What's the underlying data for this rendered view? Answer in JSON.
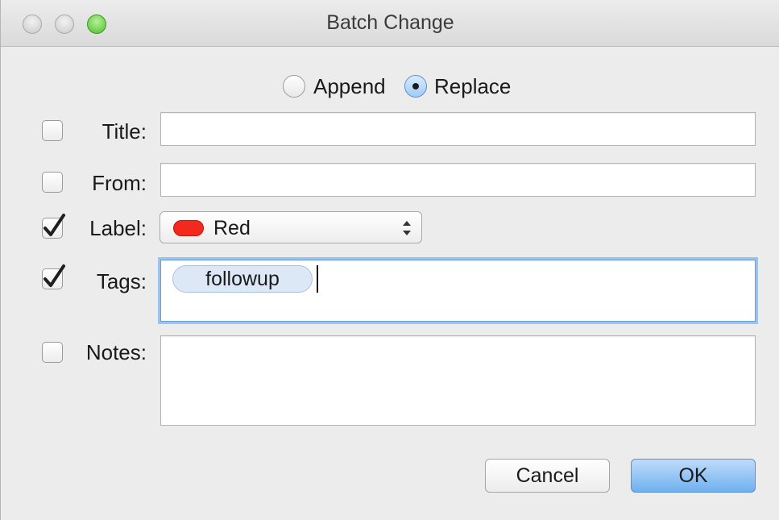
{
  "window": {
    "title": "Batch Change"
  },
  "mode": {
    "options": [
      {
        "label": "Append",
        "selected": false
      },
      {
        "label": "Replace",
        "selected": true
      }
    ]
  },
  "fields": {
    "title": {
      "label": "Title:",
      "checked": false,
      "value": ""
    },
    "from": {
      "label": "From:",
      "checked": false,
      "value": ""
    },
    "label": {
      "label": "Label:",
      "checked": true,
      "selected": "Red",
      "swatch_color": "#f2291c"
    },
    "tags": {
      "label": "Tags:",
      "checked": true,
      "tokens": [
        "followup"
      ]
    },
    "notes": {
      "label": "Notes:",
      "checked": false,
      "value": ""
    }
  },
  "buttons": {
    "cancel": "Cancel",
    "ok": "OK"
  },
  "colors": {
    "accent": "#6fb0ef",
    "focus_ring": "#9cc2ee"
  }
}
